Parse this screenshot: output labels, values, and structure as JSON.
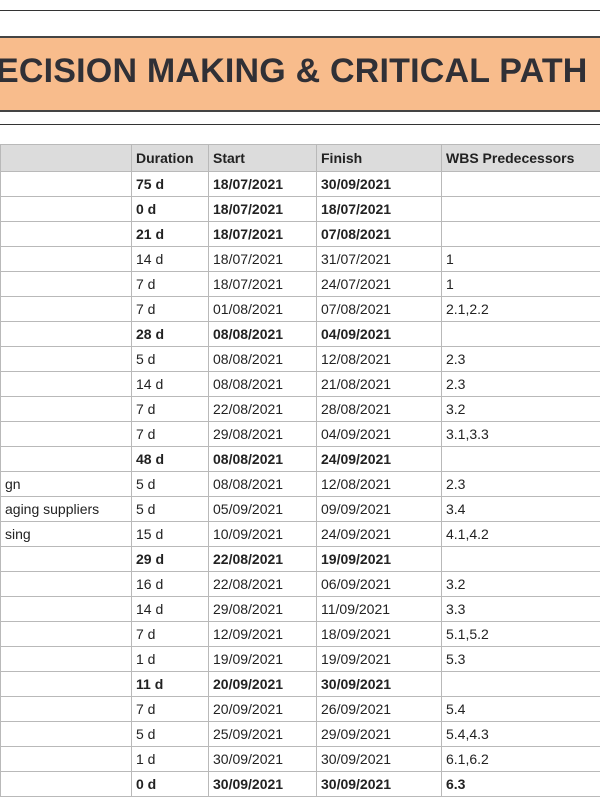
{
  "title": "ECISION MAKING & CRITICAL PATH",
  "columns": {
    "name": "",
    "duration": "Duration",
    "start": "Start",
    "finish": "Finish",
    "wbs": "WBS Predecessors"
  },
  "rows": [
    {
      "name": "",
      "duration": "75 d",
      "start": "18/07/2021",
      "finish": "30/09/2021",
      "wbs": "",
      "summary": true
    },
    {
      "name": "",
      "duration": "0 d",
      "start": "18/07/2021",
      "finish": "18/07/2021",
      "wbs": "",
      "summary": true
    },
    {
      "name": "",
      "duration": "21 d",
      "start": "18/07/2021",
      "finish": "07/08/2021",
      "wbs": "",
      "summary": true
    },
    {
      "name": "",
      "duration": "14 d",
      "start": "18/07/2021",
      "finish": "31/07/2021",
      "wbs": "1",
      "summary": false
    },
    {
      "name": "",
      "duration": "7 d",
      "start": "18/07/2021",
      "finish": "24/07/2021",
      "wbs": "1",
      "summary": false
    },
    {
      "name": "",
      "duration": "7 d",
      "start": "01/08/2021",
      "finish": "07/08/2021",
      "wbs": "2.1,2.2",
      "summary": false
    },
    {
      "name": "",
      "duration": "28 d",
      "start": "08/08/2021",
      "finish": "04/09/2021",
      "wbs": "",
      "summary": true
    },
    {
      "name": "",
      "duration": "5 d",
      "start": "08/08/2021",
      "finish": "12/08/2021",
      "wbs": "2.3",
      "summary": false
    },
    {
      "name": "",
      "duration": "14 d",
      "start": "08/08/2021",
      "finish": "21/08/2021",
      "wbs": "2.3",
      "summary": false
    },
    {
      "name": "",
      "duration": "7 d",
      "start": "22/08/2021",
      "finish": "28/08/2021",
      "wbs": "3.2",
      "summary": false
    },
    {
      "name": "",
      "duration": "7 d",
      "start": "29/08/2021",
      "finish": "04/09/2021",
      "wbs": "3.1,3.3",
      "summary": false
    },
    {
      "name": "",
      "duration": "48 d",
      "start": "08/08/2021",
      "finish": "24/09/2021",
      "wbs": "",
      "summary": true
    },
    {
      "name": "gn",
      "duration": "5 d",
      "start": "08/08/2021",
      "finish": "12/08/2021",
      "wbs": "2.3",
      "summary": false
    },
    {
      "name": "aging suppliers",
      "duration": "5 d",
      "start": "05/09/2021",
      "finish": "09/09/2021",
      "wbs": "3.4",
      "summary": false
    },
    {
      "name": "sing",
      "duration": "15 d",
      "start": "10/09/2021",
      "finish": "24/09/2021",
      "wbs": "4.1,4.2",
      "summary": false
    },
    {
      "name": "",
      "duration": "29 d",
      "start": "22/08/2021",
      "finish": "19/09/2021",
      "wbs": "",
      "summary": true
    },
    {
      "name": "",
      "duration": "16 d",
      "start": "22/08/2021",
      "finish": "06/09/2021",
      "wbs": "3.2",
      "summary": false
    },
    {
      "name": "",
      "duration": "14 d",
      "start": "29/08/2021",
      "finish": "11/09/2021",
      "wbs": "3.3",
      "summary": false
    },
    {
      "name": "",
      "duration": "7 d",
      "start": "12/09/2021",
      "finish": "18/09/2021",
      "wbs": "5.1,5.2",
      "summary": false
    },
    {
      "name": "",
      "duration": "1 d",
      "start": "19/09/2021",
      "finish": "19/09/2021",
      "wbs": "5.3",
      "summary": false
    },
    {
      "name": "",
      "duration": "11 d",
      "start": "20/09/2021",
      "finish": "30/09/2021",
      "wbs": "",
      "summary": true
    },
    {
      "name": "",
      "duration": "7 d",
      "start": "20/09/2021",
      "finish": "26/09/2021",
      "wbs": "5.4",
      "summary": false
    },
    {
      "name": "",
      "duration": "5 d",
      "start": "25/09/2021",
      "finish": "29/09/2021",
      "wbs": "5.4,4.3",
      "summary": false
    },
    {
      "name": "",
      "duration": "1 d",
      "start": "30/09/2021",
      "finish": "30/09/2021",
      "wbs": "6.1,6.2",
      "summary": false
    },
    {
      "name": "",
      "duration": "0 d",
      "start": "30/09/2021",
      "finish": "30/09/2021",
      "wbs": "6.3",
      "summary": true
    }
  ]
}
